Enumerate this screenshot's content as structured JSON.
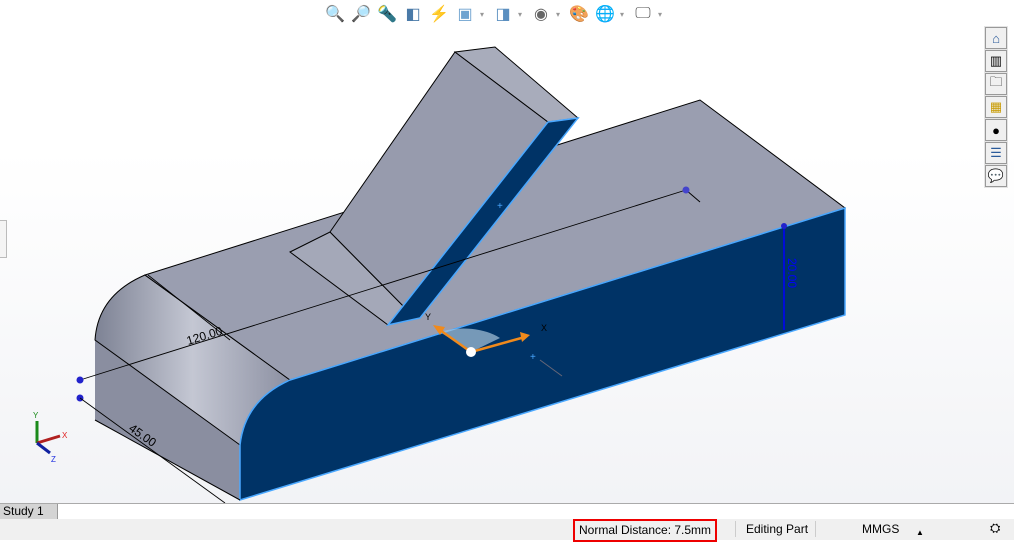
{
  "toolbar": {
    "icons": [
      "zoom-to-fit-icon",
      "zoom-to-area-icon",
      "previous-view-icon",
      "section-view-icon",
      "dynamic-annotation-icon",
      "view-orientation-icon",
      "display-style-icon",
      "hide-show-icon",
      "edit-appearance-icon",
      "apply-scene-icon",
      "view-settings-icon"
    ]
  },
  "taskpane": {
    "icons": [
      "home-icon",
      "resources-icon",
      "file-explorer-icon",
      "view-palette-icon",
      "appearances-icon",
      "custom-properties-icon",
      "forum-icon"
    ]
  },
  "model": {
    "dimensions": {
      "length": "120.00",
      "width": "45.00",
      "height": "20.00"
    },
    "triad": {
      "x": "X",
      "y": "Y"
    },
    "axes": {
      "x": "X",
      "y": "Y",
      "z": "Z"
    },
    "colors": {
      "top_face": "#9a9eb0",
      "selected_face": "#003366",
      "edge_highlight": "#4aa8ff"
    }
  },
  "tabs": {
    "study": "Study 1"
  },
  "status": {
    "normal_distance": "Normal Distance: 7.5mm",
    "mode": "Editing Part",
    "units": "MMGS",
    "units_arrow": "▲"
  }
}
